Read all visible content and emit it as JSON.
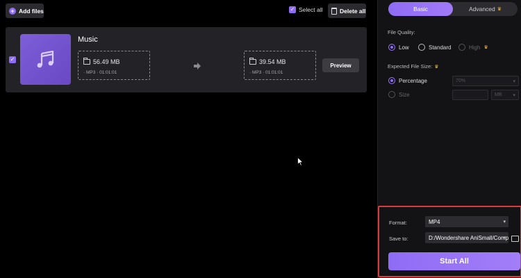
{
  "toolbar": {
    "add_files_label": "Add files",
    "select_all_label": "Select all",
    "delete_all_label": "Delete all"
  },
  "file": {
    "name": "Music",
    "source": {
      "size": "56.49 MB",
      "meta": "· MP3 · 01:01:01"
    },
    "output": {
      "size": "39.54 MB",
      "meta": "· MP3 · 01:01:01"
    },
    "preview_label": "Preview"
  },
  "panel": {
    "tabs": [
      {
        "label": "Basic",
        "active": true
      },
      {
        "label": "Advanced",
        "active": false
      }
    ],
    "quality": {
      "label": "File Quality:",
      "options": [
        {
          "label": "Low",
          "selected": true
        },
        {
          "label": "Standard",
          "selected": false
        },
        {
          "label": "High",
          "selected": false
        }
      ]
    },
    "expected_size": {
      "label": "Expected File Size:",
      "percentage_label": "Percentage",
      "percentage_value": "70%",
      "size_label": "Size",
      "size_unit": "MB"
    },
    "format": {
      "label": "Format:",
      "value": "MP4"
    },
    "save_to": {
      "label": "Save to:",
      "value": "D:/Wondershare AniSmall/Comp"
    },
    "start_all_label": "Start All"
  },
  "colors": {
    "accent": "#8f6cf5",
    "highlight_border": "#d93c3c",
    "premium_icon": "#f5b931"
  },
  "icons": [
    "plus-icon",
    "checkbox-icon",
    "trash-icon",
    "music-note-icon",
    "folder-icon",
    "arrow-right-icon",
    "crown-icon",
    "chevron-down-icon",
    "open-folder-icon",
    "cursor-icon"
  ]
}
